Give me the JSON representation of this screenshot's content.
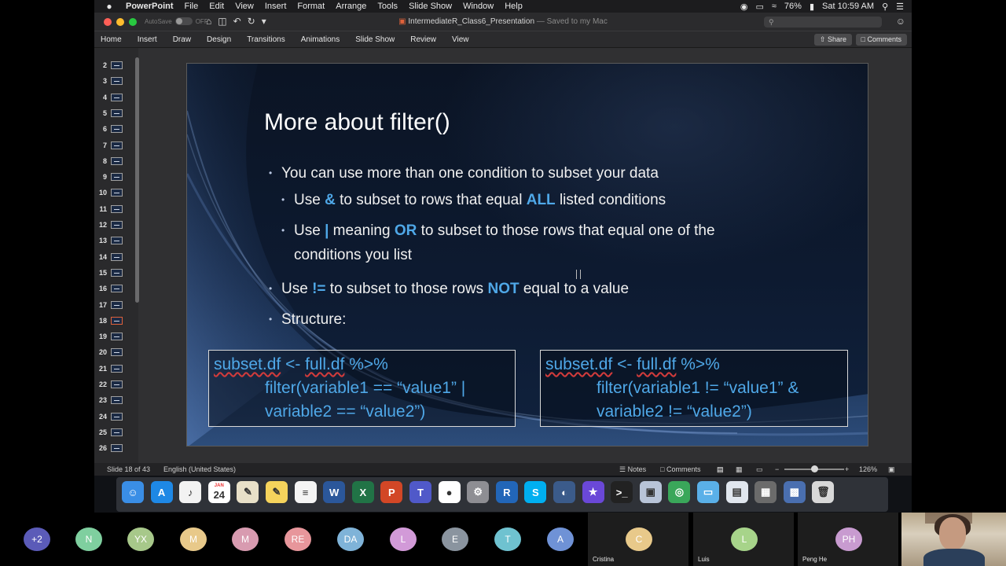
{
  "menubar": {
    "apple": "",
    "app_name": "PowerPoint",
    "items": [
      "File",
      "Edit",
      "View",
      "Insert",
      "Format",
      "Arrange",
      "Tools",
      "Slide Show",
      "Window",
      "Help"
    ],
    "battery": "76%",
    "clock": "Sat 10:59 AM"
  },
  "titlebar": {
    "autosave_label": "AutoSave",
    "autosave_state": "OFF",
    "doc_name": "IntermediateR_Class6_Presentation",
    "saved_status": "— Saved to my Mac"
  },
  "ribbon": {
    "tabs": [
      "Home",
      "Insert",
      "Draw",
      "Design",
      "Transitions",
      "Animations",
      "Slide Show",
      "Review",
      "View"
    ],
    "share_label": "Share",
    "comments_label": "Comments"
  },
  "thumbnails": {
    "numbers": [
      "2",
      "3",
      "4",
      "5",
      "6",
      "7",
      "8",
      "9",
      "10",
      "11",
      "12",
      "13",
      "14",
      "15",
      "16",
      "17",
      "18",
      "19",
      "20",
      "21",
      "22",
      "23",
      "24",
      "25",
      "26"
    ],
    "active": "18"
  },
  "slide": {
    "title": "More about filter()",
    "b1": "You can use more than one condition to subset your data",
    "b2_pre": "Use ",
    "b2_hl1": "&",
    "b2_mid": " to subset to rows that equal ",
    "b2_hl2": "ALL",
    "b2_post": " listed conditions",
    "b3_pre": "Use ",
    "b3_hl1": "|",
    "b3_mid": " meaning ",
    "b3_hl2": "OR",
    "b3_post": " to subset to those rows that equal one of the",
    "b3_line2": "conditions you list",
    "b4_pre": "Use ",
    "b4_hl1": "!=",
    "b4_mid": " to subset to those rows ",
    "b4_hl2": "NOT",
    "b4_post": " equal to a value",
    "b5": "Structure:",
    "code_left": {
      "l1_a": "subset.df",
      "l1_b": " <- ",
      "l1_c": "full.df",
      "l1_d": " %>%",
      "l2": "filter(variable1 == “value1” |",
      "l3": "variable2 == “value2”)"
    },
    "code_right": {
      "l1_a": "subset.df",
      "l1_b": " <- ",
      "l1_c": "full.df",
      "l1_d": " %>%",
      "l2": "filter(variable1 != “value1” &",
      "l3": "variable2 != “value2”)"
    }
  },
  "statusbar": {
    "slide_info": "Slide 18 of 43",
    "language": "English (United States)",
    "notes_label": "Notes",
    "comments_label": "Comments",
    "zoom_minus": "−",
    "zoom_plus": "+",
    "zoom_value": "126%",
    "zoom_level_fraction": 0.45
  },
  "dock": {
    "icons": [
      "finder-icon",
      "app-store-icon",
      "itunes-icon",
      "calendar-icon",
      "notes-icon",
      "stickies-icon",
      "textedit-icon",
      "word-icon",
      "excel-icon",
      "powerpoint-icon",
      "teams-icon",
      "chrome-icon",
      "system-preferences-icon",
      "r-icon",
      "skype-icon",
      "screen-share-icon",
      "imovie-icon",
      "terminal-icon",
      "preview-icon",
      "activity-icon",
      "folder-icon",
      "downloads-icon",
      "screenshot-icon",
      "keynote-icon",
      "trash-icon"
    ],
    "calendar_day": "24",
    "calendar_month": "JAN"
  },
  "participants": {
    "overflow": "+2",
    "initials": [
      "N",
      "YX",
      "M",
      "M",
      "RE",
      "DA",
      "L",
      "E",
      "T",
      "A"
    ],
    "named": [
      {
        "initials": "C",
        "name": "Cristina"
      },
      {
        "initials": "L",
        "name": "Luis"
      },
      {
        "initials": "PH",
        "name": "Peng He"
      }
    ]
  },
  "colors": {
    "slide_bg": "#0d1a30",
    "highlight": "#4fa8e8",
    "active_thumb": "#e0623a"
  }
}
